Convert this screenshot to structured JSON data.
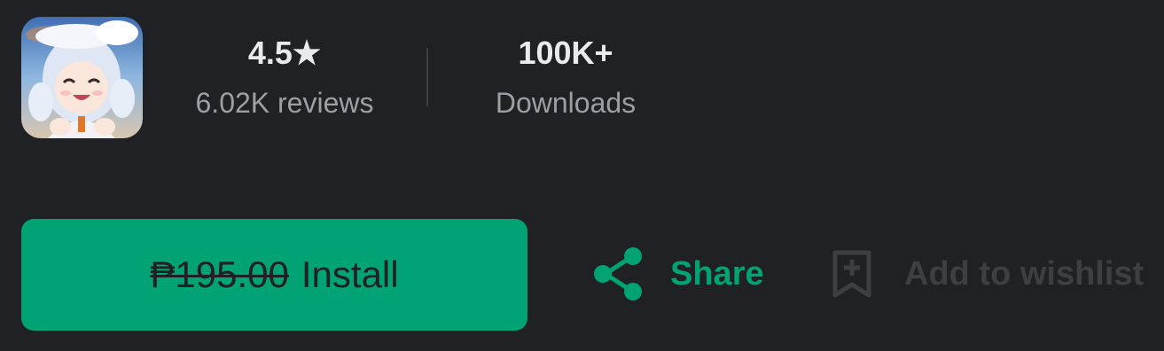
{
  "app": {
    "icon": "anime-character-app-icon"
  },
  "stats": {
    "rating_value": "4.5",
    "rating_star": "★",
    "reviews_label": "6.02K reviews",
    "downloads_value": "100K+",
    "downloads_label": "Downloads"
  },
  "actions": {
    "install_price": "₱195.00",
    "install_label": "Install",
    "share_label": "Share",
    "wishlist_label": "Add to wishlist"
  },
  "colors": {
    "background": "#202124",
    "accent": "#01a274",
    "text_primary": "#e8eaed",
    "text_secondary": "#9aa0a6",
    "disabled": "#3c4043"
  }
}
